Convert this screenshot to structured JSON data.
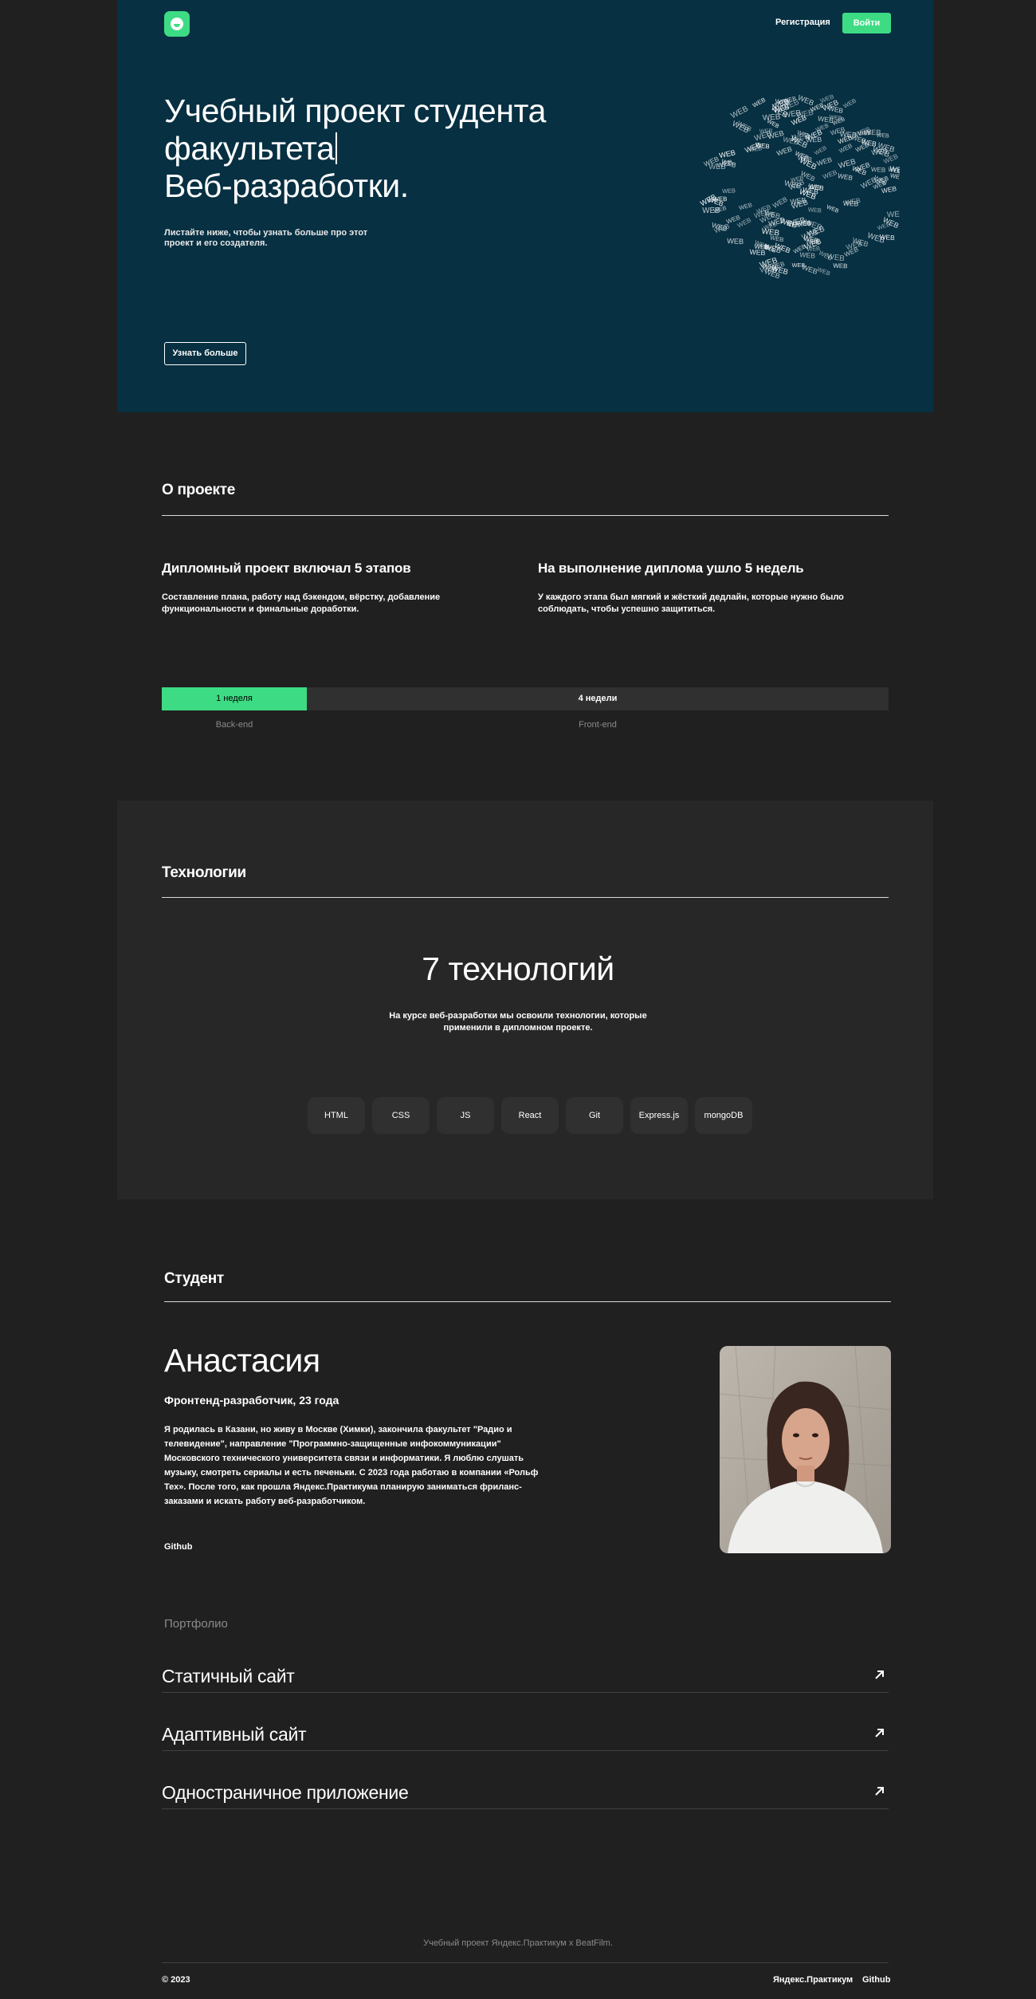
{
  "header": {
    "register": "Регистрация",
    "login": "Войти"
  },
  "hero": {
    "title_line1": "Учебный проект студента",
    "title_line2": "факультета",
    "title_line3": "Веб-разработки.",
    "subtitle": "Листайте ниже, чтобы узнать больше про этот проект и его создателя.",
    "button": "Узнать больше",
    "globe_word": "WEB"
  },
  "about": {
    "title": "О проекте",
    "col1_heading": "Дипломный проект включал 5 этапов",
    "col1_text": "Составление плана, работу над бэкендом, вёрстку, добавление функциональности и финальные доработки.",
    "col2_heading": "На выполнение диплома ушло 5 недель",
    "col2_text": "У каждого этапа был мягкий и жёсткий дедлайн, которые нужно было соблюдать, чтобы успешно защититься.",
    "timeline": {
      "backend_duration": "1 неделя",
      "frontend_duration": "4 недели",
      "backend_label": "Back-end",
      "frontend_label": "Front-end"
    }
  },
  "techs": {
    "title": "Технологии",
    "heading": "7 технологий",
    "description": "На курсе веб-разработки мы освоили технологии, которые применили в дипломном проекте.",
    "items": [
      "HTML",
      "CSS",
      "JS",
      "React",
      "Git",
      "Express.js",
      "mongoDB"
    ]
  },
  "student": {
    "title": "Студент",
    "name": "Анастасия",
    "role": "Фронтенд-разработчик, 23 года",
    "bio": "Я родилась в Казани, но живу в Москве (Химки), закончила факультет \"Радио и телевидение\", направление \"Программно-защищенные инфокоммуникации\" Московского технического университета связи и информатики. Я люблю слушать музыку, смотреть сериалы и есть печеньки. С 2023 года работаю в компании «Рольф Тех». После того, как прошла Яндекс.Практикума планирую заниматься фриланс-заказами и искать работу веб-разработчиком.",
    "github": "Github"
  },
  "portfolio": {
    "title": "Портфолио",
    "items": [
      {
        "label": "Статичный сайт",
        "icon": "arrow-up-right-icon"
      },
      {
        "label": "Адаптивный сайт",
        "icon": "arrow-up-right-icon"
      },
      {
        "label": "Одностраничное приложение",
        "icon": "arrow-up-right-icon"
      }
    ]
  },
  "footer": {
    "note": "Учебный проект Яндекс.Практикум х BeatFilm.",
    "copyright": "© 2023",
    "links": [
      "Яндекс.Практикум",
      "Github"
    ]
  },
  "colors": {
    "hero_bg": "#073042",
    "page_bg": "#202020",
    "tech_bg": "#272727",
    "accent": "#3ddc84",
    "muted": "#8b8b8b"
  }
}
